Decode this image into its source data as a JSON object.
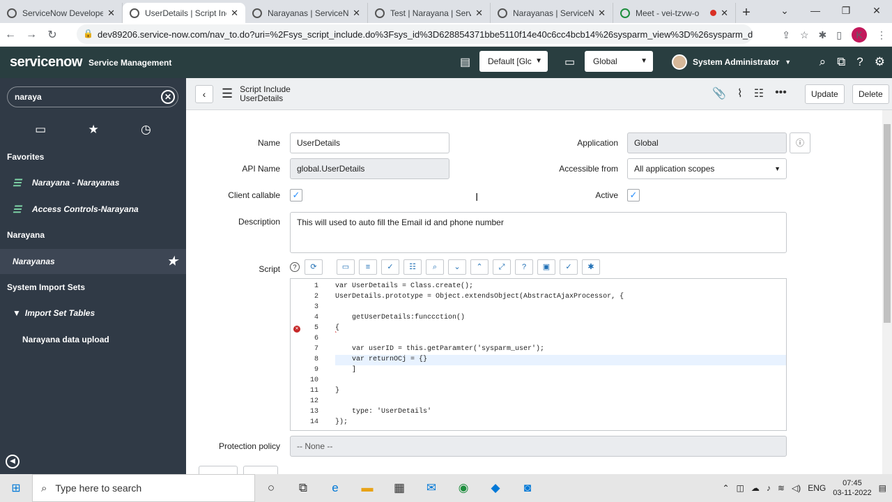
{
  "browser": {
    "tabs": [
      {
        "title": "ServiceNow Develope",
        "active": false
      },
      {
        "title": "UserDetails | Script Inc",
        "active": true
      },
      {
        "title": "Narayanas | ServiceNo",
        "active": false
      },
      {
        "title": "Test | Narayana | Serv",
        "active": false
      },
      {
        "title": "Narayanas | ServiceNo",
        "active": false
      },
      {
        "title": "Meet - vei-tzvw-o",
        "active": false
      }
    ],
    "url": "dev89206.service-now.com/nav_to.do?uri=%2Fsys_script_include.do%3Fsys_id%3D628854371bbe5110f14e40c6cc4bcb14%26sysparm_view%3D%26sysparm_doma...",
    "profile_initial": "K"
  },
  "header": {
    "logo": "servicenow",
    "product": "Service Management",
    "update_set": "Default [Glc",
    "scope": "Global",
    "user": "System Administrator"
  },
  "sidebar": {
    "filter_value": "naraya",
    "favorites_label": "Favorites",
    "favorites": [
      "Narayana - Narayanas",
      "Access Controls-Narayana"
    ],
    "section1": "Narayana",
    "section1_item": "Narayanas",
    "section2": "System Import Sets",
    "section2_sub": "Import Set Tables",
    "section2_item": "Narayana data upload"
  },
  "form": {
    "record_type": "Script Include",
    "record_name": "UserDetails",
    "update_label": "Update",
    "delete_label": "Delete",
    "labels": {
      "name": "Name",
      "api_name": "API Name",
      "client_callable": "Client callable",
      "description": "Description",
      "script": "Script",
      "application": "Application",
      "accessible_from": "Accessible from",
      "active": "Active",
      "protection": "Protection policy"
    },
    "name": "UserDetails",
    "api_name": "global.UserDetails",
    "application": "Global",
    "accessible_from": "All application scopes",
    "client_callable": true,
    "active": true,
    "description": "This will used to auto fill the  Email id and phone number",
    "protection_policy": "-- None --",
    "script_lines": [
      "var UserDetails = Class.create();",
      "UserDetails.prototype = Object.extendsObject(AbstractAjaxProcessor, {",
      "",
      "    getUserDetails:funccction()",
      "{",
      "",
      "    var userID = this.getParamter('sysparm_user');",
      "    var returnOCj = {}",
      "    ]",
      "",
      "}",
      "",
      "    type: 'UserDetails'",
      "});"
    ]
  },
  "taskbar": {
    "search_placeholder": "Type here to search",
    "lang": "ENG",
    "time": "07:45",
    "date": "03-11-2022"
  }
}
